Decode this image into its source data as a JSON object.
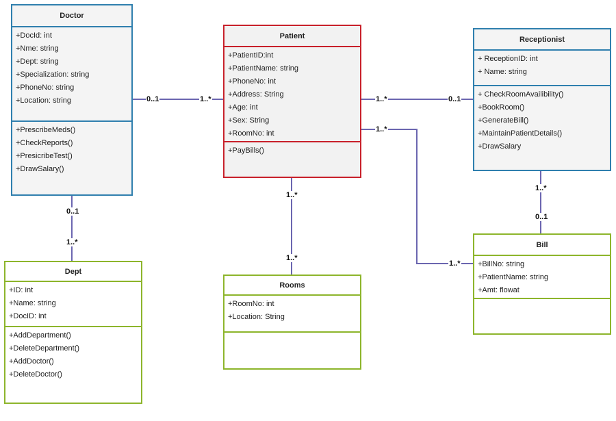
{
  "colors": {
    "class_border_blue": "#2f7fae",
    "class_border_red": "#c8202a",
    "class_border_green": "#8db52b",
    "connector": "#6b66b0"
  },
  "classes": {
    "doctor": {
      "name": "Doctor",
      "attributes": [
        "+DocId: int",
        "+Nme: string",
        "+Dept: string",
        "+Specialization: string",
        "+PhoneNo: string",
        "+Location: string"
      ],
      "methods": [
        "+PrescribeMeds()",
        "+CheckReports()",
        "+PresicribeTest()",
        "+DrawSalary()"
      ]
    },
    "patient": {
      "name": "Patient",
      "attributes": [
        "+PatientID:int",
        "+PatientName: string",
        "+PhoneNo: int",
        "+Address: String",
        "+Age: int",
        "+Sex: String",
        "+RoomNo: int"
      ],
      "methods": [
        "+PayBills()"
      ]
    },
    "receptionist": {
      "name": "Receptionist",
      "attributes": [
        "+ ReceptionID: int",
        "+ Name: string"
      ],
      "methods": [
        "+ CheckRoomAvailibility()",
        "+BookRoom()",
        "+GenerateBill()",
        "+MaintainPatientDetails()",
        "+DrawSalary"
      ]
    },
    "dept": {
      "name": "Dept",
      "attributes": [
        "+ID: int",
        "+Name: string",
        "+DocID: int"
      ],
      "methods": [
        "+AddDepartment()",
        "+DeleteDepartment()",
        "+AddDoctor()",
        "+DeleteDoctor()"
      ]
    },
    "rooms": {
      "name": "Rooms",
      "attributes": [
        "+RoomNo: int",
        "+Location: String"
      ],
      "methods": []
    },
    "bill": {
      "name": "Bill",
      "attributes": [
        "+BillNo: string",
        "+PatientName: string",
        "+Amt: flowat"
      ],
      "methods": []
    }
  },
  "associations": [
    {
      "from": "Doctor",
      "to": "Patient",
      "from_mult": "0..1",
      "to_mult": "1..*"
    },
    {
      "from": "Patient",
      "to": "Receptionist",
      "from_mult": "1..*",
      "to_mult": "0..1"
    },
    {
      "from": "Patient",
      "to": "Bill",
      "from_mult": "1..*",
      "to_mult": "1..*"
    },
    {
      "from": "Doctor",
      "to": "Dept",
      "from_mult": "0..1",
      "to_mult": "1..*"
    },
    {
      "from": "Patient",
      "to": "Rooms",
      "from_mult": "1..*",
      "to_mult": "1..*"
    },
    {
      "from": "Receptionist",
      "to": "Bill",
      "from_mult": "1..*",
      "to_mult": "0..1"
    }
  ]
}
